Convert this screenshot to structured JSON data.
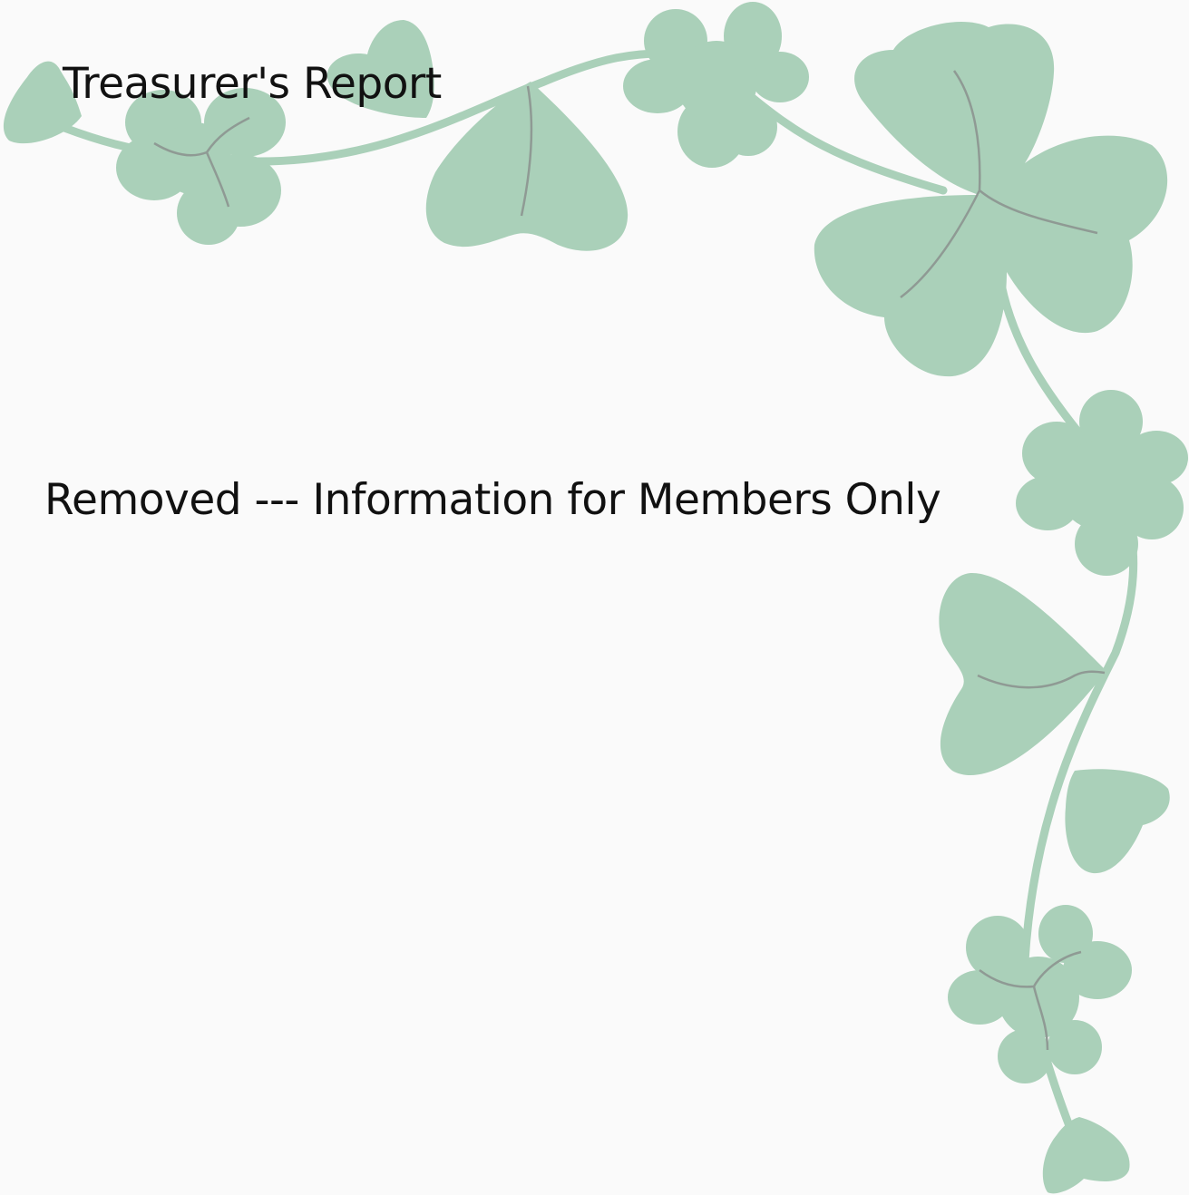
{
  "page": {
    "title": "Treasurer's Report",
    "notice": "Removed --- Information for Members Only"
  },
  "colors": {
    "background": "#fafafa",
    "text": "#111111",
    "clover": "#aad0b9",
    "vein": "#8f9a94"
  },
  "decoration": {
    "icon": "shamrock-vine-border"
  }
}
